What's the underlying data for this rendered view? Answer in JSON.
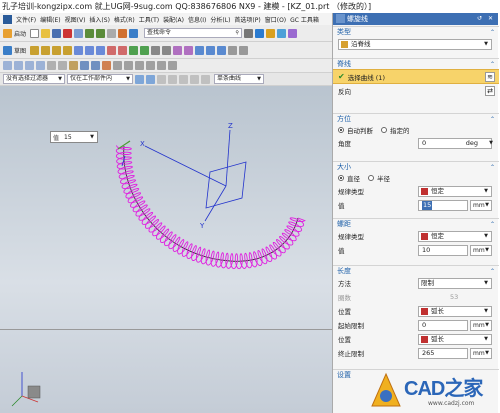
{
  "window_title": "孔子培训-kongzipx.com 就上UG网-9sug.com QQ:838676806 NX9 - 建模 - [KZ_01.prt （修改的）]",
  "menubar": {
    "items": [
      "文件(F)",
      "编辑(E)",
      "视图(V)",
      "插入(S)",
      "格式(R)",
      "工具(T)",
      "装配(A)",
      "信息(I)",
      "分析(L)",
      "首选项(P)",
      "窗口(O)",
      "GC 工具箱"
    ]
  },
  "toolbar": {
    "start_label": "启动",
    "command_search_placeholder": "查找命令",
    "sketch_label": "草图",
    "selection_filter": "没有选择过滤器",
    "scope": "仅在工作部件内",
    "curve_rule": "单条曲线"
  },
  "viewport": {
    "value_label": "值",
    "value_input": "15",
    "axes": {
      "z": "Z",
      "x": "X",
      "y": "Y"
    }
  },
  "dialog": {
    "title": "螺旋线",
    "type": {
      "header": "类型",
      "value": "沿脊线"
    },
    "spine": {
      "header": "脊线",
      "select_label": "选择曲线 (1)",
      "reverse_label": "反向"
    },
    "orientation": {
      "header": "方位",
      "auto_label": "自动判断",
      "specified_label": "指定的",
      "angle_label": "角度",
      "angle_value": "0",
      "angle_unit": "deg"
    },
    "size": {
      "header": "大小",
      "diameter_label": "直径",
      "radius_label": "半径",
      "law_label": "规律类型",
      "law_value": "恒定",
      "value_label": "值",
      "value": "15",
      "unit": "mm"
    },
    "pitch": {
      "header": "螺距",
      "law_label": "规律类型",
      "law_value": "恒定",
      "value_label": "值",
      "value": "10",
      "unit": "mm"
    },
    "length": {
      "header": "长度",
      "method_label": "方法",
      "method_value": "限制",
      "turns_label": "圈数",
      "turns_value": "53",
      "position_label": "位置",
      "position_value": "弧长",
      "start_label": "起始限制",
      "start_value": "0",
      "start_unit": "mm",
      "position2_label": "位置",
      "position2_value": "弧长",
      "end_label": "终止限制",
      "end_value": "265",
      "end_unit": "mm"
    },
    "settings": {
      "header": "设置"
    }
  },
  "watermark": {
    "text": "CAD之家",
    "url": "www.cadzj.com"
  }
}
